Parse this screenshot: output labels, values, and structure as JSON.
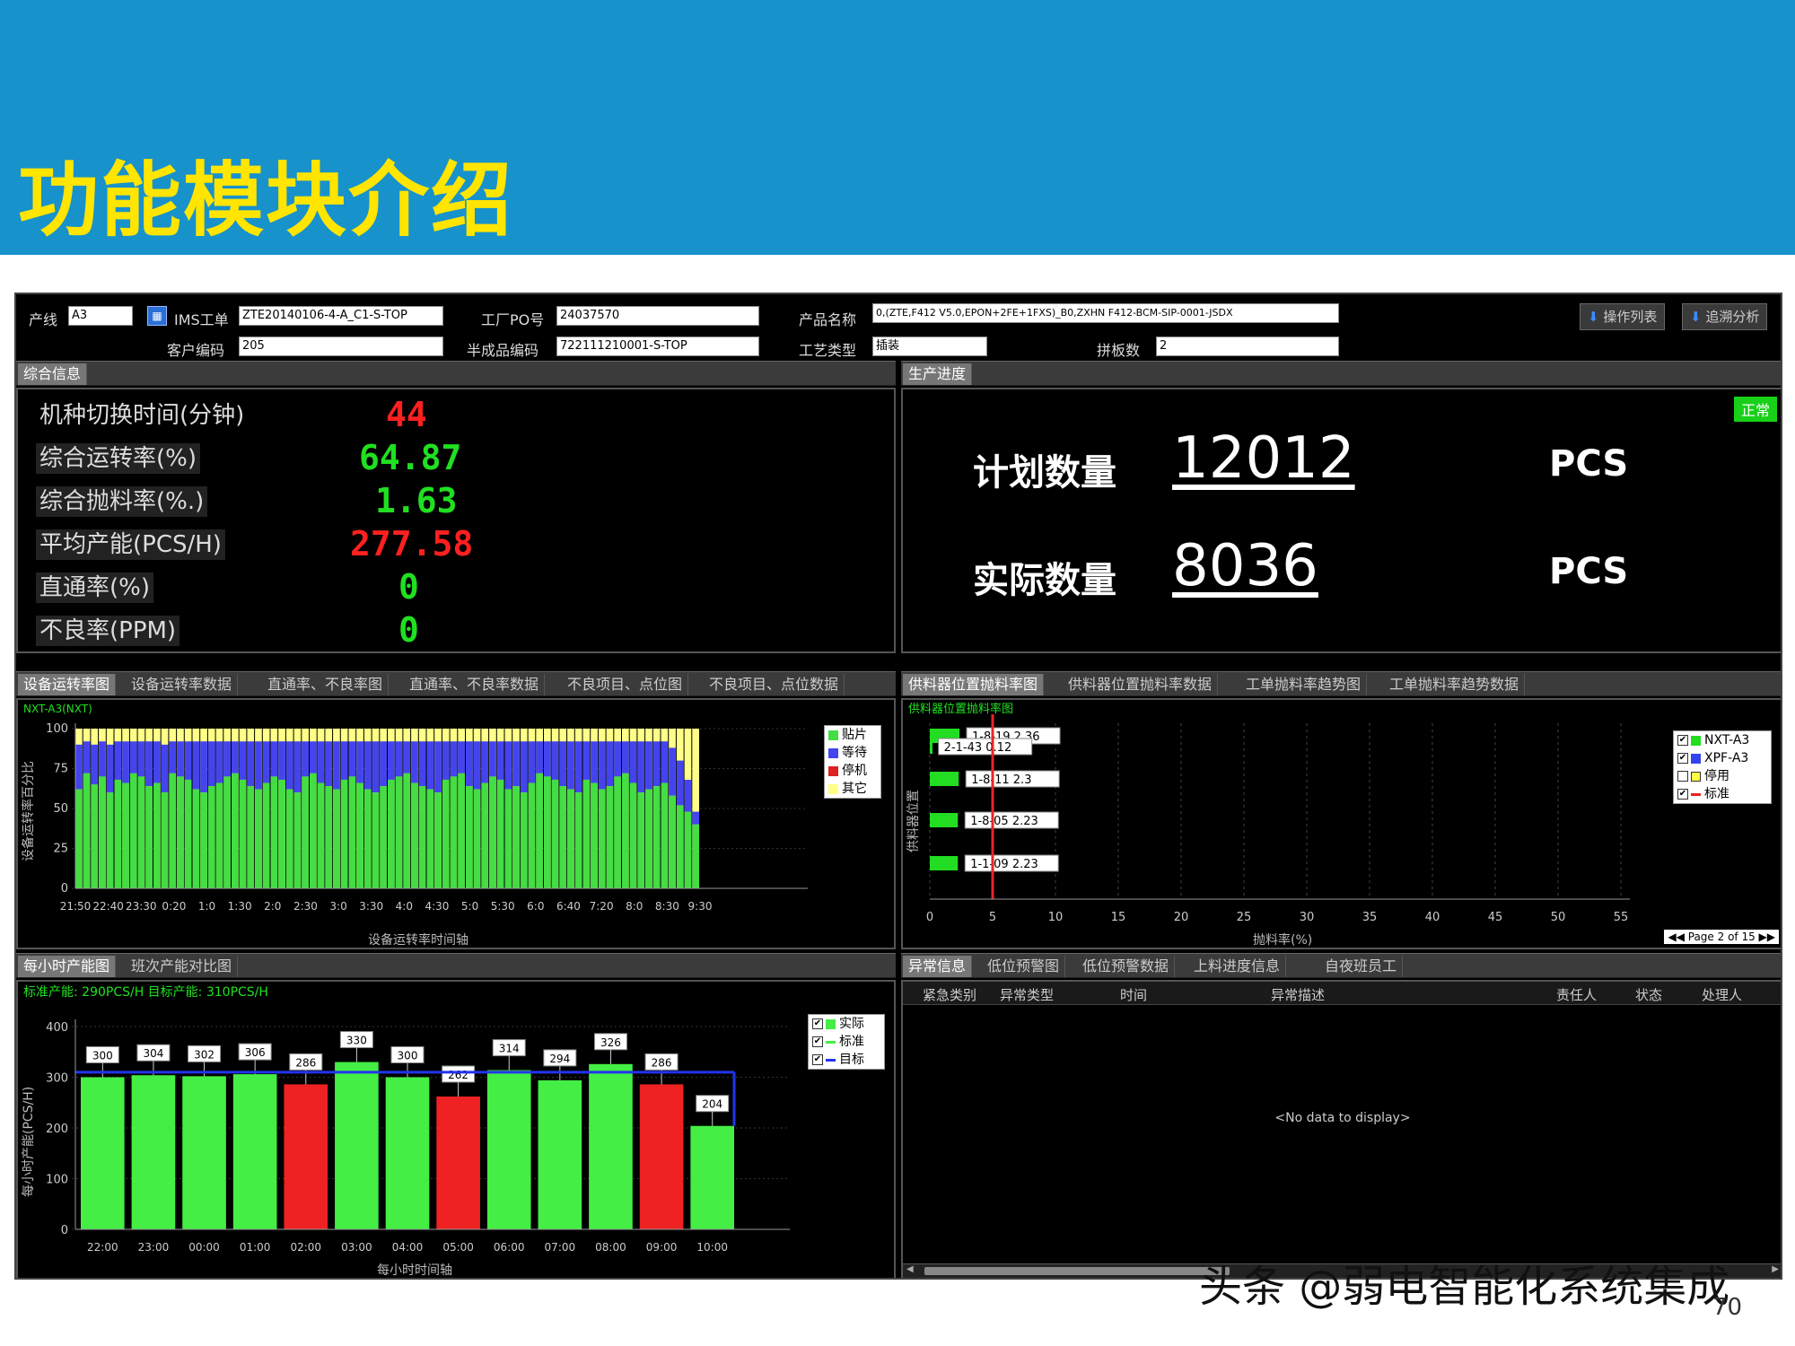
{
  "slide": {
    "title": "功能模块介绍",
    "watermark": "头条 @弱电智能化系统集成",
    "page_number": "70"
  },
  "header": {
    "line_label": "产线",
    "line_value": "A3",
    "ims_label": "IMS工单",
    "ims_value": "ZTE20140106-4-A_C1-S-TOP",
    "factory_po_label": "工厂PO号",
    "factory_po_value": "24037570",
    "product_label": "产品名称",
    "product_value": "0,(ZTE,F412 V5.0,EPON+2FE+1FXS)_B0,ZXHN F412-BCM-SIP-0001-JSDX",
    "customer_label": "客户编码",
    "customer_value": "205",
    "semi_label": "半成品编码",
    "semi_value": "722111210001-S-TOP",
    "process_label": "工艺类型",
    "process_value": "插装",
    "board_label": "拼板数",
    "board_value": "2",
    "btn_ops": "操作列表",
    "btn_trace": "追溯分析"
  },
  "summary": {
    "bar_label": "综合信息",
    "metrics": [
      {
        "label": "机种切换时间(分钟)",
        "value": "44"
      },
      {
        "label": "综合运转率(%)",
        "value": "64.87"
      },
      {
        "label": "综合抛料率(%.)",
        "value": "1.63"
      },
      {
        "label": "平均产能(PCS/H)",
        "value": "277.58"
      },
      {
        "label": "直通率(%)",
        "value": "0"
      },
      {
        "label": "不良率(PPM)",
        "value": "0"
      }
    ],
    "colors": {
      "red": "#ff2020",
      "green": "#20e020"
    }
  },
  "progress": {
    "bar_label": "生产进度",
    "status_badge": "正常",
    "plan_label": "计划数量",
    "plan_value": "12012",
    "actual_label": "实际数量",
    "actual_value": "8036",
    "unit": "PCS"
  },
  "tabs_left_mid": [
    "设备运转率图",
    "设备运转率数据",
    "直通率、不良率图",
    "直通率、不良率数据",
    "不良项目、点位图",
    "不良项目、点位数据"
  ],
  "tabs_right_mid": [
    "供料器位置抛料率图",
    "供料器位置抛料率数据",
    "工单抛料率趋势图",
    "工单抛料率趋势数据"
  ],
  "tabs_left_bot": [
    "每小时产能图",
    "班次产能对比图"
  ],
  "tabs_right_bot": [
    "异常信息",
    "低位预警图",
    "低位预警数据",
    "上料进度信息",
    "自夜班员工"
  ],
  "uptime_chart": {
    "chart_data": {
      "type": "bar",
      "title": "NXT-A3(NXT)",
      "ylabel": "设备运转率百分比",
      "xlabel": "设备运转率时间轴",
      "ylim": [
        0,
        100
      ],
      "yticks": [
        0,
        25,
        50,
        75,
        100
      ],
      "xticks": [
        "21:50",
        "22:40",
        "23:30",
        "0:20",
        "1:0",
        "1:30",
        "2:0",
        "2:30",
        "3:0",
        "3:30",
        "4:0",
        "4:30",
        "5:0",
        "5:30",
        "6:0",
        "6:40",
        "7:20",
        "8:0",
        "8:30",
        "9:30"
      ],
      "stack_note": "each bar: 贴片 (green) bottom, 等待 (blue) middle, 其它 (yellow) top to 100",
      "series": [
        {
          "name": "贴片",
          "color": "#44dd44",
          "values": [
            62,
            72,
            65,
            70,
            60,
            68,
            66,
            72,
            70,
            64,
            66,
            60,
            72,
            70,
            68,
            62,
            60,
            64,
            66,
            70,
            72,
            68,
            64,
            62,
            66,
            70,
            68,
            62,
            60,
            70,
            72,
            66,
            64,
            62,
            68,
            70,
            66,
            62,
            60,
            64,
            68,
            70,
            72,
            66,
            64,
            62,
            60,
            68,
            70,
            72,
            64,
            62,
            66,
            70,
            68,
            62,
            64,
            60,
            66,
            72,
            70,
            68,
            64,
            62,
            60,
            68,
            66,
            62,
            64,
            70,
            72,
            66,
            60,
            62,
            64,
            66,
            58,
            52,
            48,
            40
          ]
        },
        {
          "name": "等待",
          "color": "#4444ee",
          "values": [
            28,
            20,
            25,
            22,
            30,
            24,
            26,
            20,
            22,
            28,
            26,
            30,
            20,
            22,
            24,
            30,
            32,
            28,
            26,
            22,
            20,
            24,
            28,
            30,
            26,
            22,
            24,
            30,
            32,
            22,
            20,
            26,
            28,
            30,
            24,
            22,
            26,
            30,
            32,
            28,
            24,
            22,
            20,
            26,
            28,
            30,
            32,
            24,
            22,
            20,
            28,
            30,
            26,
            22,
            24,
            30,
            28,
            32,
            26,
            20,
            22,
            24,
            28,
            30,
            32,
            24,
            26,
            30,
            28,
            22,
            20,
            26,
            32,
            30,
            28,
            26,
            30,
            28,
            20,
            8
          ]
        },
        {
          "name": "停机",
          "color": "#dd2222",
          "values": []
        },
        {
          "name": "其它",
          "color": "#ffff88",
          "values": []
        }
      ]
    }
  },
  "feeder_chart": {
    "chart_data": {
      "type": "bar",
      "title": "供料器位置抛料率图",
      "ylabel": "供料器位置",
      "xlabel": "抛料率(%)",
      "xlim": [
        0,
        55
      ],
      "xticks": [
        0,
        5,
        10,
        15,
        20,
        25,
        30,
        35,
        40,
        45,
        50,
        55
      ],
      "categories": [
        "1-8-19",
        "2-1-43",
        "1-8-11",
        "1-8-05",
        "1-1-09"
      ],
      "values": [
        2.36,
        0.12,
        2.3,
        2.23,
        2.23
      ],
      "labels": [
        "1-8-19  2.36",
        "2-1-43  0.12",
        "1-8-11  2.3",
        "1-8-05  2.23",
        "1-1-09  2.23"
      ],
      "standard_line": 5,
      "legend": [
        "NXT-A3",
        "XPF-A3",
        "停用",
        "标准"
      ],
      "pager": "Page 2 of 15"
    }
  },
  "hourly_chart": {
    "chart_data": {
      "type": "bar",
      "title": "标准产能: 290PCS/H 目标产能: 310PCS/H",
      "ylabel": "每小时产能(PCS/H)",
      "xlabel": "每小时时间轴",
      "ylim": [
        0,
        400
      ],
      "yticks": [
        0,
        100,
        200,
        300,
        400
      ],
      "categories": [
        "22:00",
        "23:00",
        "00:00",
        "01:00",
        "02:00",
        "03:00",
        "04:00",
        "05:00",
        "06:00",
        "07:00",
        "08:00",
        "09:00",
        "10:00"
      ],
      "values": [
        300,
        304,
        302,
        306,
        286,
        330,
        300,
        262,
        314,
        294,
        326,
        286,
        204
      ],
      "colors": [
        "#44ee44",
        "#44ee44",
        "#44ee44",
        "#44ee44",
        "#ee2222",
        "#44ee44",
        "#44ee44",
        "#ee2222",
        "#44ee44",
        "#44ee44",
        "#44ee44",
        "#ee2222",
        "#44ee44"
      ],
      "standard": 290,
      "target": 310,
      "legend": [
        "实际",
        "标准",
        "目标"
      ]
    }
  },
  "anomaly": {
    "columns": [
      "紧急类别",
      "异常类型",
      "时间",
      "异常描述",
      "责任人",
      "状态",
      "处理人"
    ],
    "empty_text": "<No data to display>"
  }
}
